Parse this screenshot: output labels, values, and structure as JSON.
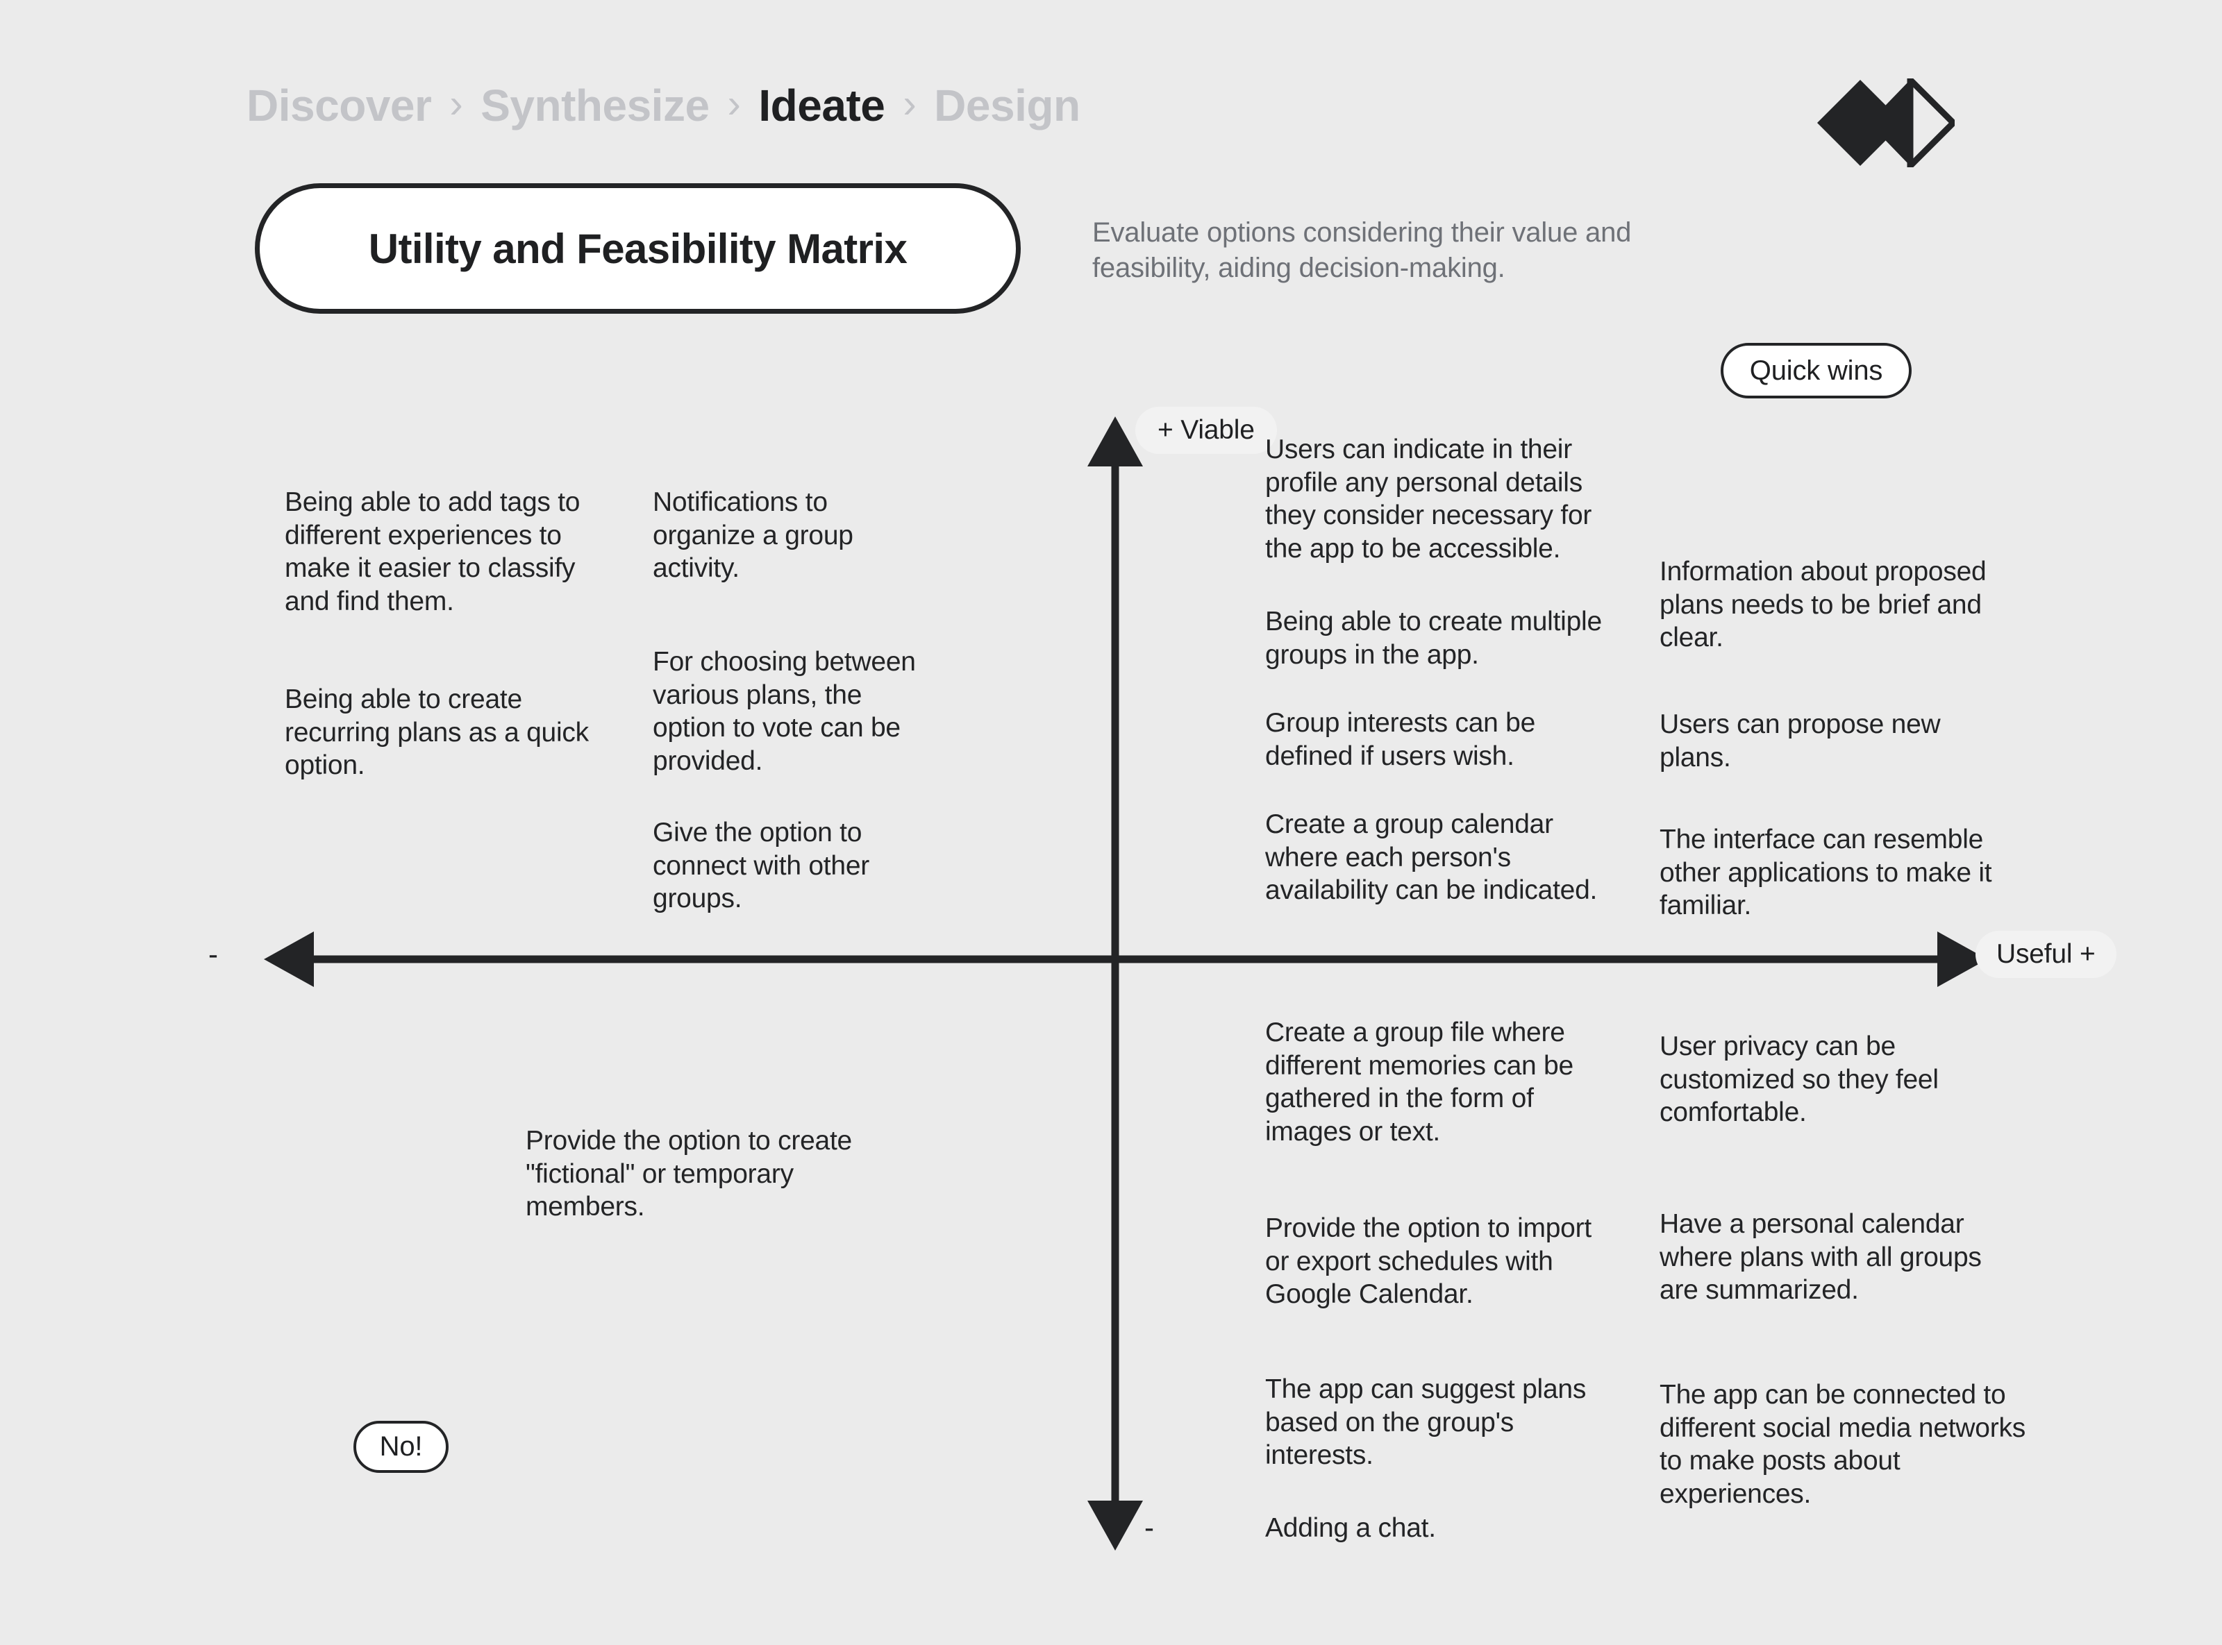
{
  "breadcrumb": {
    "separator": "›",
    "items": [
      {
        "label": "Discover",
        "active": false
      },
      {
        "label": "Synthesize",
        "active": false
      },
      {
        "label": "Ideate",
        "active": true
      },
      {
        "label": "Design",
        "active": false
      }
    ]
  },
  "header": {
    "title": "Utility and Feasibility Matrix",
    "subtitle": "Evaluate options considering their value and feasibility, aiding decision-making.",
    "logo_name": "double-diamond-logo"
  },
  "matrix": {
    "quick_wins_label": "Quick wins",
    "no_label": "No!",
    "axis_y_positive": "+ Viable",
    "axis_y_negative": "-",
    "axis_x_positive": "Useful  +",
    "axis_x_negative": "-"
  },
  "notes": {
    "top_left_col1": [
      "Being able to add tags to different experiences to make it easier to classify and find them.",
      "Being able to create recurring plans as a quick option."
    ],
    "top_left_col2": [
      " Notifications to organize a group activity.",
      "For choosing between various plans, the option to vote can be provided.",
      " Give the option to connect with other groups."
    ],
    "top_right_col1": [
      "Users can indicate in their profile any personal details they consider necessary for the app to be accessible.",
      "Being able to create multiple groups in the app.",
      "Group interests can be defined if users wish.",
      "Create a group calendar where each person's availability can be indicated."
    ],
    "top_right_col2": [
      "Information about proposed plans needs to be brief and clear.",
      "Users can propose new plans.",
      "The interface can resemble other applications to make it familiar."
    ],
    "bottom_left_col1": [
      "Provide the option to create \"fictional\" or temporary members."
    ],
    "bottom_right_col1": [
      "Create a group file where different memories can be gathered in the form of images or text.",
      "Provide the option to import or export schedules with Google Calendar.",
      "The app can suggest plans based on the group's interests.",
      "Adding a chat."
    ],
    "bottom_right_col2": [
      "User privacy can be customized so they feel comfortable.",
      "Have a personal calendar where plans with all groups are summarized.",
      "The app can be connected to different social media networks to make posts about experiences."
    ]
  },
  "colors": {
    "background": "#ebebeb",
    "ink": "#232426",
    "muted": "#c3c4c8",
    "subtitle": "#6e7177",
    "pill_fill": "#ffffff",
    "axis_label_fill": "#f2f2f2"
  }
}
